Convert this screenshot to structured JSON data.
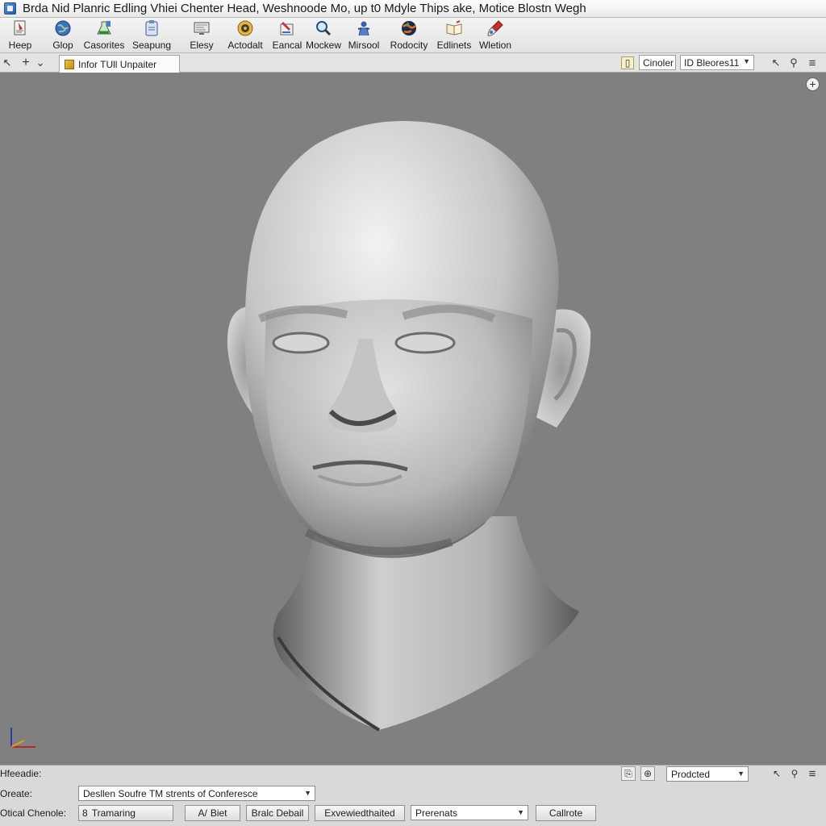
{
  "title_bar": {
    "title": "Brda Nid Planric Edling Vhiei Chenter Head, Weshnoode Mo, up t0 Mdyle Thips ake, Motice Blostn Wegh"
  },
  "toolbar": {
    "items": [
      {
        "label": "Heep",
        "icon": "help-document-icon"
      },
      {
        "label": "Glop",
        "icon": "globe-icon"
      },
      {
        "label": "Casorites",
        "icon": "flask-icon"
      },
      {
        "label": "Seapung",
        "icon": "clipboard-icon"
      },
      {
        "label": "Elesy",
        "icon": "monitor-icon"
      },
      {
        "label": "Actodalt",
        "icon": "gold-coin-icon"
      },
      {
        "label": "Eancal",
        "icon": "pen-chart-icon"
      },
      {
        "label": "Mockew",
        "icon": "magnifier-icon"
      },
      {
        "label": "Mirsool",
        "icon": "person-icon"
      },
      {
        "label": "Rodocity",
        "icon": "planet-icon"
      },
      {
        "label": "Edlinets",
        "icon": "open-book-icon"
      },
      {
        "label": "Wletion",
        "icon": "brush-icon"
      }
    ]
  },
  "subbar": {
    "arrow_glyph": "↖",
    "plus_glyph": "+",
    "chevron_glyph": "⌄",
    "tab_label": "Infor TUll Unpaiter",
    "folder_glyph": "▯",
    "field_label": "Cinoler",
    "dropdown_value": "ID Bleores11",
    "cursor_glyph": "↖",
    "wrench_glyph": "⚲",
    "menu_glyph": "≡"
  },
  "viewport": {
    "background": "#808080",
    "add_glyph": "+"
  },
  "bottom_panel": {
    "header_label": "Hfeeadie:",
    "status_icons": {
      "left": "⎘",
      "right": "⊕"
    },
    "mode_select": "Prodcted",
    "tool_glyphs": {
      "cursor": "↖",
      "wrench": "⚲",
      "menu": "≡"
    },
    "row1_label": "Oreate:",
    "row1_select": "Desllen Soufre TM strents of Conferesce",
    "row2_label": "Otical Chenole:",
    "buttons": [
      {
        "label": "Tramaring",
        "icon": "8"
      },
      {
        "label": "Biet",
        "icon": "A/"
      },
      {
        "label": "Bralc Debail"
      },
      {
        "label": "Exvewiedthaited"
      }
    ],
    "row2_select": "Prerenats",
    "final_button": "Callrote"
  },
  "colors": {
    "viewport_bg": "#808080",
    "model_light": "#efefef",
    "model_shadow": "#3a3a3a",
    "panel_bg": "#d9d9d9"
  }
}
